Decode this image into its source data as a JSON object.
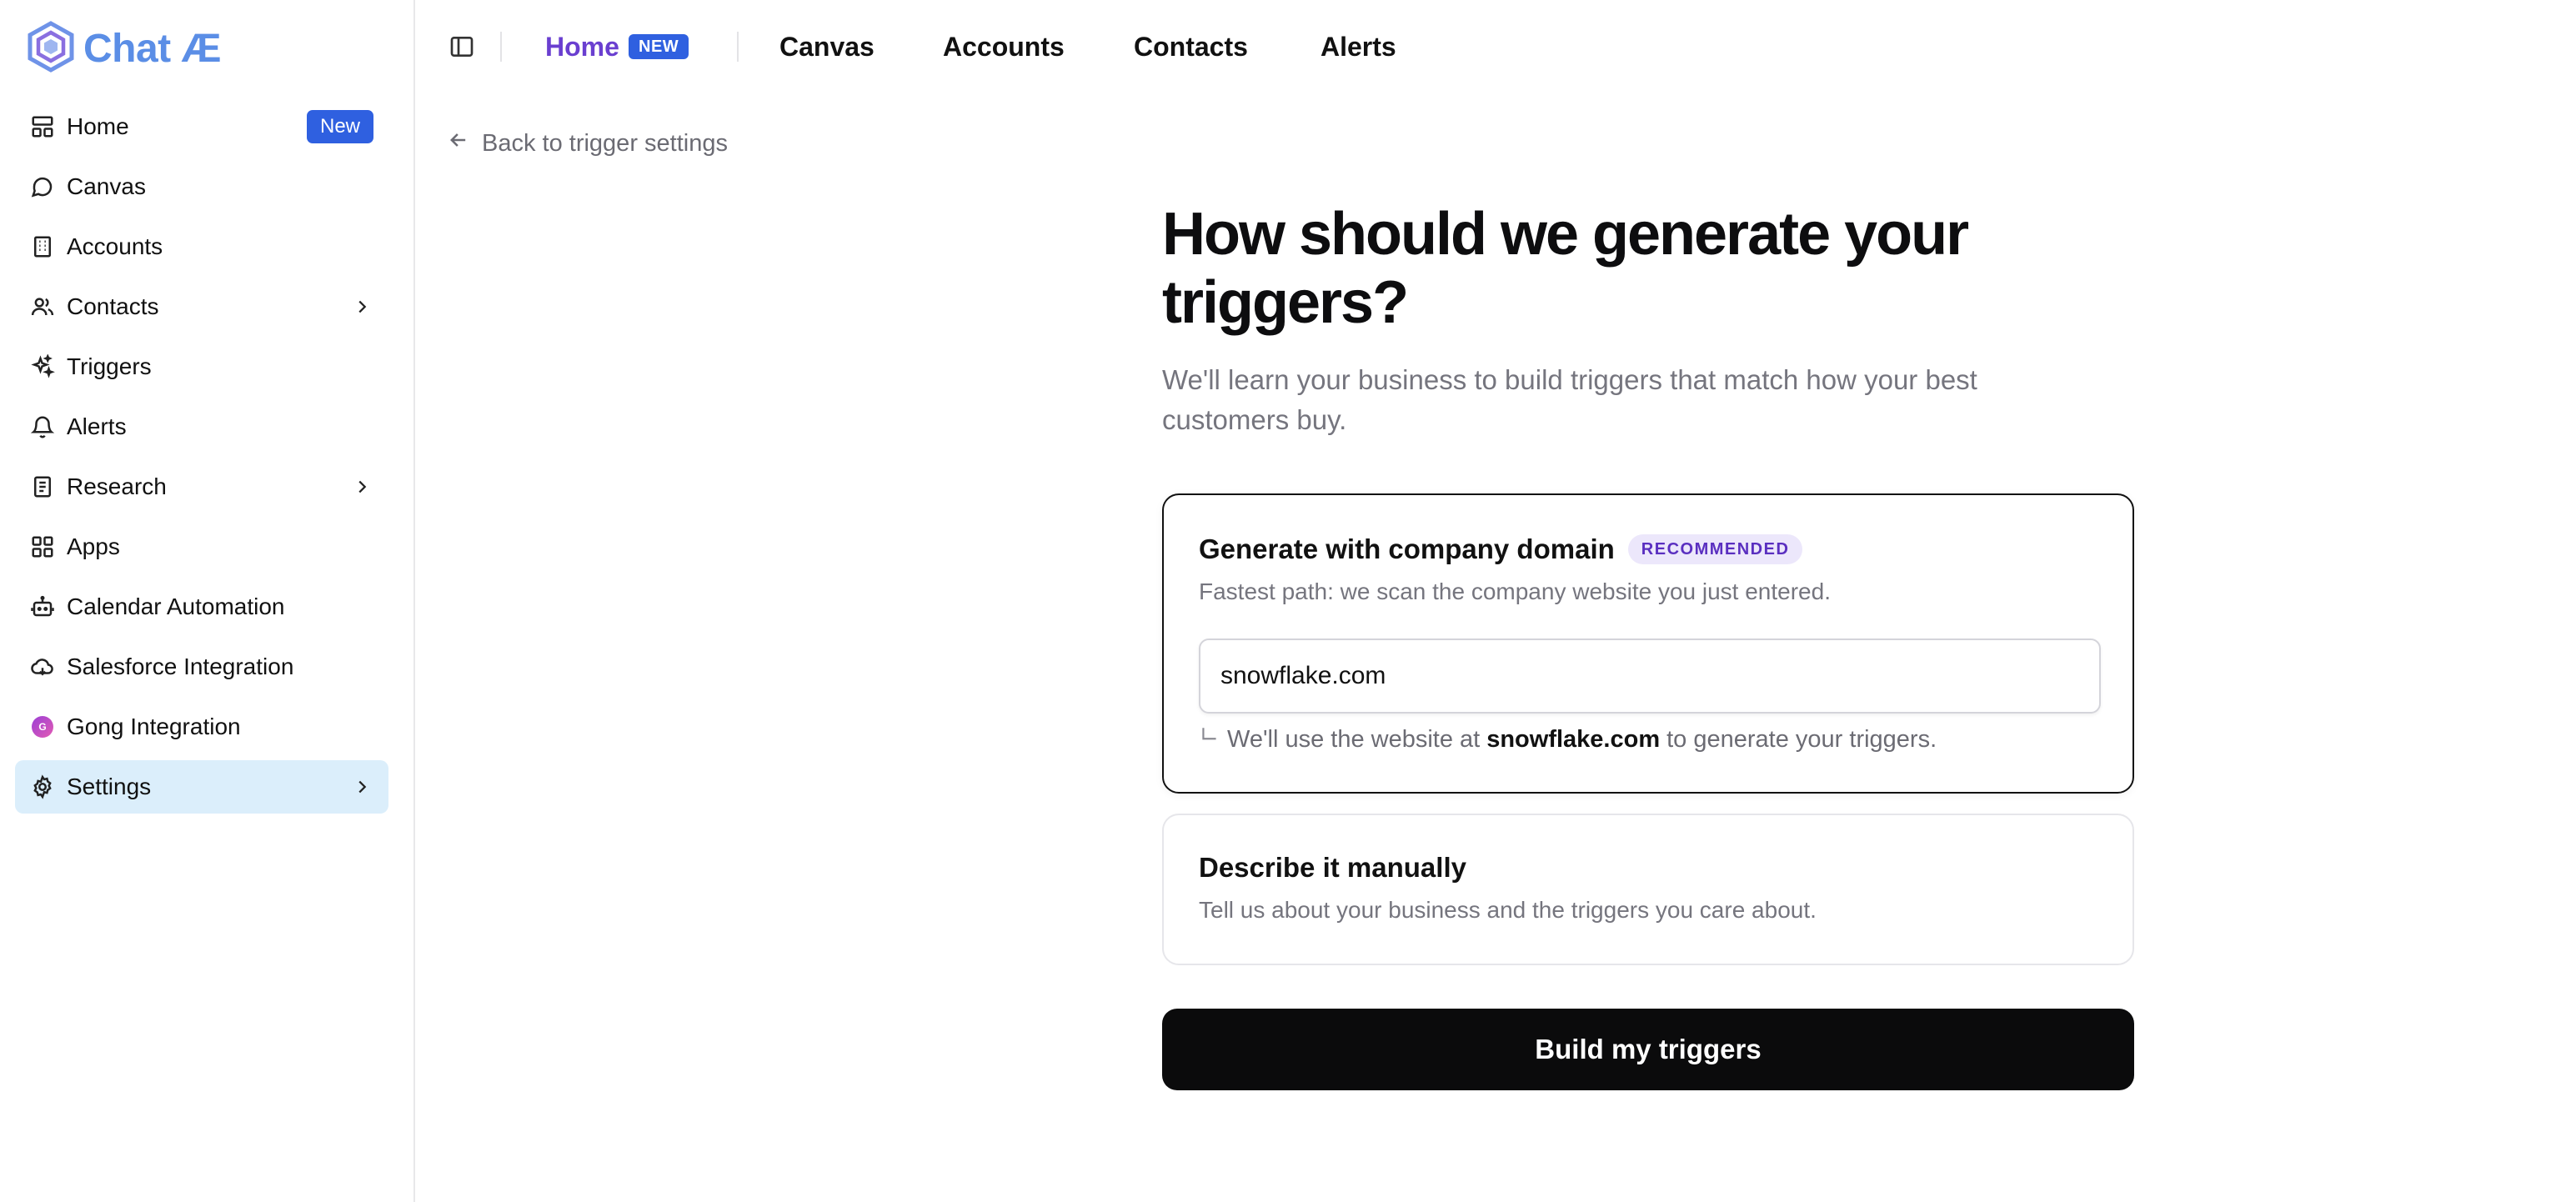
{
  "brand": {
    "name": "Chat Æ",
    "accent": "#5b8ee6"
  },
  "sidebar": {
    "items": [
      {
        "label": "Home",
        "icon": "layout-icon",
        "badge": "New"
      },
      {
        "label": "Canvas",
        "icon": "chat-bubble-icon"
      },
      {
        "label": "Accounts",
        "icon": "building-icon"
      },
      {
        "label": "Contacts",
        "icon": "users-icon",
        "has_chevron": true
      },
      {
        "label": "Triggers",
        "icon": "sparkles-icon"
      },
      {
        "label": "Alerts",
        "icon": "bell-icon"
      },
      {
        "label": "Research",
        "icon": "notebook-icon",
        "has_chevron": true
      },
      {
        "label": "Apps",
        "icon": "grid-icon"
      },
      {
        "label": "Calendar Automation",
        "icon": "bot-icon"
      },
      {
        "label": "Salesforce Integration",
        "icon": "cloud-icon"
      },
      {
        "label": "Gong Integration",
        "icon": "gong-logo-icon",
        "icon_text": "G"
      },
      {
        "label": "Settings",
        "icon": "gear-icon",
        "has_chevron": true,
        "active": true
      }
    ]
  },
  "topbar": {
    "tabs": [
      {
        "label": "Home",
        "badge": "NEW",
        "active": true
      },
      {
        "label": "Canvas"
      },
      {
        "label": "Accounts"
      },
      {
        "label": "Contacts"
      },
      {
        "label": "Alerts"
      }
    ]
  },
  "back_link": {
    "label": "Back to trigger settings"
  },
  "main": {
    "title": "How should we generate your triggers?",
    "subtitle": "We'll learn your business to build triggers that match how your best customers buy.",
    "option_domain": {
      "title": "Generate with company domain",
      "badge": "RECOMMENDED",
      "description": "Fastest path: we scan the company website you just entered.",
      "input_value": "snowflake.com",
      "hint_prefix": "We'll use the website at",
      "hint_domain": "snowflake.com",
      "hint_suffix": "to generate your triggers.",
      "selected": true
    },
    "option_manual": {
      "title": "Describe it manually",
      "description": "Tell us about your business and the triggers you care about."
    },
    "submit_label": "Build my triggers"
  },
  "colors": {
    "active_tab": "#6a3fd0",
    "new_badge": "#2f60e0",
    "active_nav_bg": "#dbeefb",
    "recommended_badge_bg": "#ece7fb",
    "recommended_badge_text": "#5a2fc0",
    "primary_button": "#0b0b0c"
  }
}
